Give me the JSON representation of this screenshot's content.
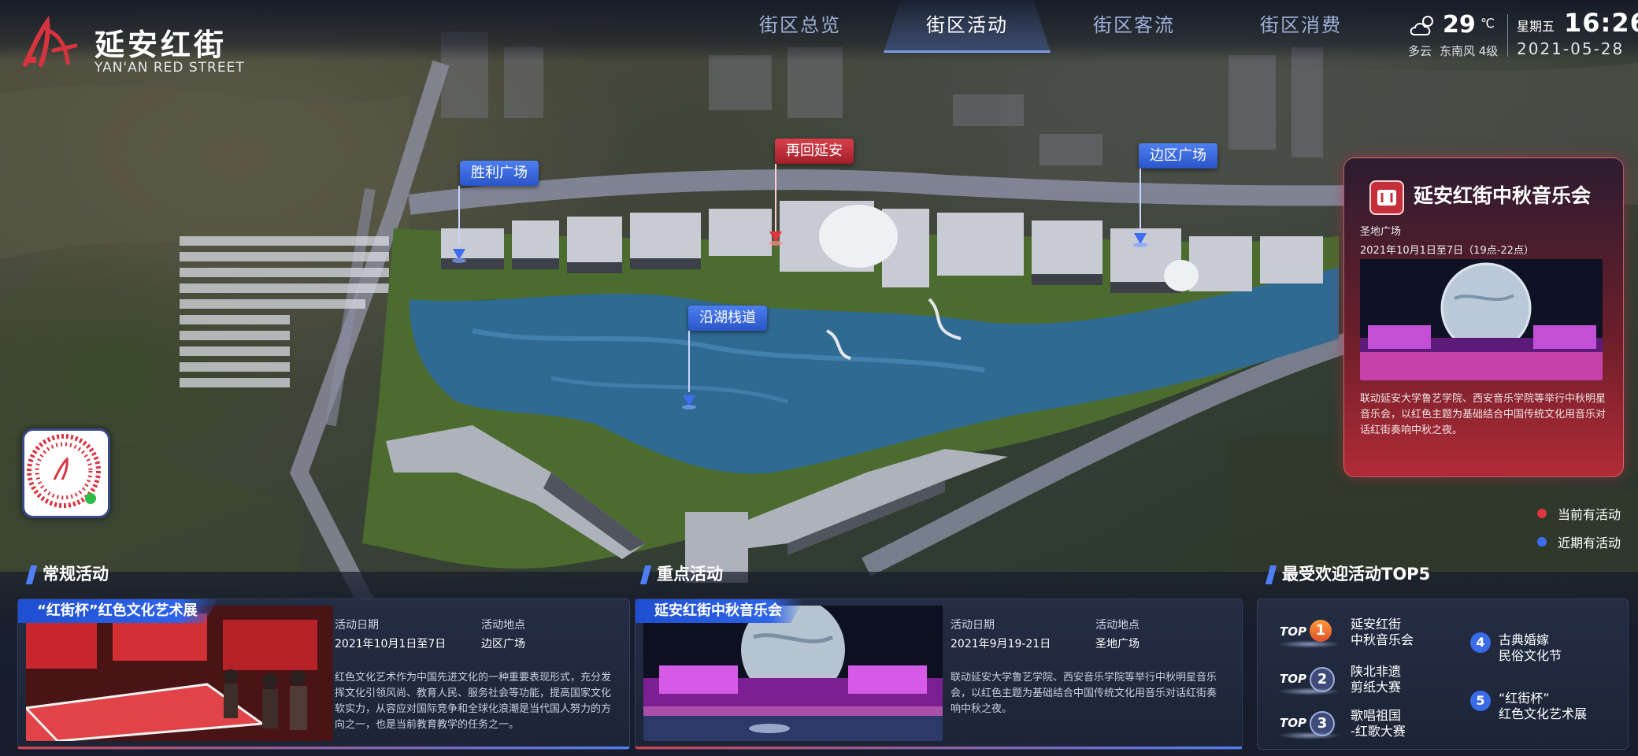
{
  "brand": {
    "title": "延安红街",
    "subtitle": "YAN'AN RED STREET"
  },
  "nav": {
    "tabs": [
      {
        "label": "街区总览",
        "active": false
      },
      {
        "label": "街区活动",
        "active": true
      },
      {
        "label": "街区客流",
        "active": false
      },
      {
        "label": "街区消费",
        "active": false
      }
    ]
  },
  "weather": {
    "temp": "29",
    "unit": "℃",
    "condition": "多云",
    "wind": "东南风 4级",
    "icon": "cloud-sun-icon"
  },
  "datetime": {
    "weekday": "星期五",
    "time": "16:26",
    "date": "2021-05-28"
  },
  "map_pins": [
    {
      "label": "胜利广场",
      "status": "upcoming"
    },
    {
      "label": "再回延安",
      "status": "current"
    },
    {
      "label": "边区广场",
      "status": "upcoming"
    },
    {
      "label": "沿湖栈道",
      "status": "upcoming"
    }
  ],
  "featured": {
    "title": "延安红街中秋音乐会",
    "venue": "圣地广场",
    "time": "2021年10月1日至7日（19点-22点）",
    "description": "联动延安大学鲁艺学院、西安音乐学院等举行中秋明星音乐会，以红色主题为基础结合中国传统文化用音乐对话红街奏响中秋之夜。"
  },
  "legend": {
    "current": "当前有活动",
    "upcoming": "近期有活动",
    "colors": {
      "current": "#e0353f",
      "upcoming": "#3f6df0"
    }
  },
  "regular": {
    "section_title": "常规活动",
    "tag": "“红街杯”红色文化艺术展",
    "date_label": "活动日期",
    "date_value": "2021年10月1日至7日",
    "place_label": "活动地点",
    "place_value": "边区广场",
    "description": "红色文化艺术作为中国先进文化的一种重要表现形式，充分发挥文化引领风尚、教育人民、服务社会等功能，提高国家文化软实力，从容应对国际竞争和全球化浪潮是当代国人努力的方向之一，也是当前教育教学的任务之一。"
  },
  "key": {
    "section_title": "重点活动",
    "tag": "延安红街中秋音乐会",
    "date_label": "活动日期",
    "date_value": "2021年9月19-21日",
    "place_label": "活动地点",
    "place_value": "圣地广场",
    "description": "联动延安大学鲁艺学院、西安音乐学院等举行中秋明星音乐会，以红色主题为基础结合中国传统文化用音乐对话红街奏响中秋之夜。"
  },
  "top5": {
    "section_title": "最受欢迎活动TOP5",
    "top_label": "TOP",
    "items": [
      {
        "rank": "1",
        "name": "延安红街\n中秋音乐会"
      },
      {
        "rank": "2",
        "name": "陕北非遗\n剪纸大赛"
      },
      {
        "rank": "3",
        "name": "歌唱祖国\n-红歌大赛"
      },
      {
        "rank": "4",
        "name": "古典婚嫁\n民俗文化节"
      },
      {
        "rank": "5",
        "name": "“红街杯”\n红色文化艺术展"
      }
    ]
  }
}
